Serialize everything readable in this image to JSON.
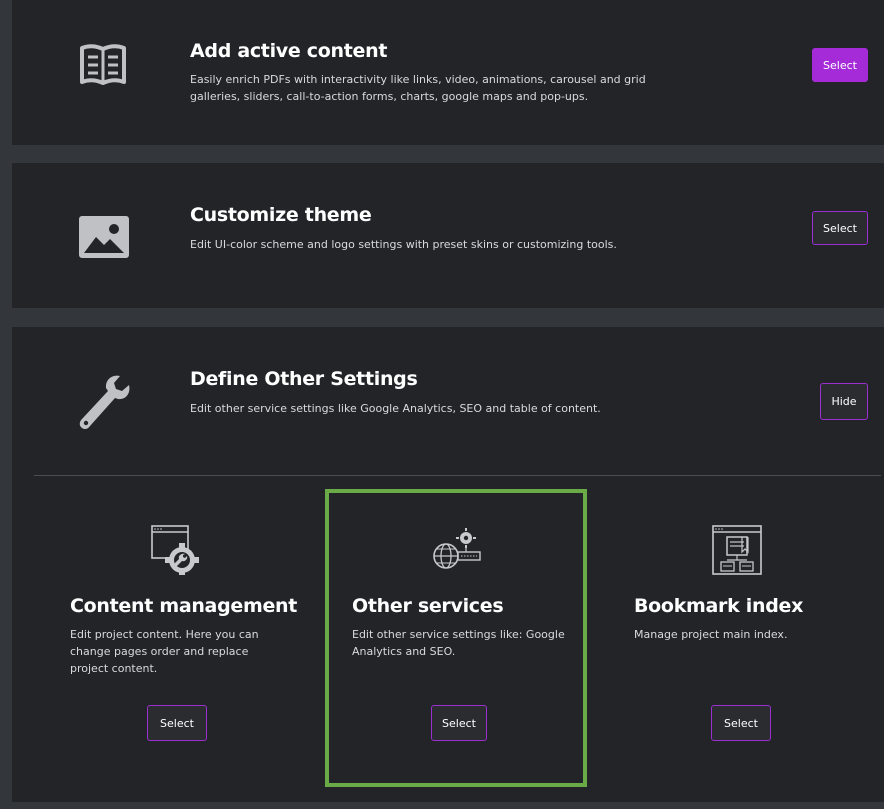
{
  "active_content": {
    "title": "Add active content",
    "description": "Easily enrich PDFs with interactivity like links, video, animations, carousel and grid galleries, sliders, call-to-action forms, charts, google maps and pop-ups.",
    "button_label": "Select",
    "icon": "book-icon"
  },
  "customize_theme": {
    "title": "Customize theme",
    "description": "Edit UI-color scheme and logo settings with preset skins or customizing tools.",
    "button_label": "Select",
    "icon": "image-icon"
  },
  "other_settings": {
    "title": "Define Other Settings",
    "description": "Edit other service settings like Google Analytics, SEO and table of content.",
    "button_label": "Hide",
    "icon": "wrench-icon",
    "cards": [
      {
        "title": "Content management",
        "description": "Edit project content. Here you can change pages order and replace project content.",
        "button_label": "Select",
        "icon": "settings-window-icon"
      },
      {
        "title": "Other services",
        "description": "Edit other service settings like: Google Analytics and SEO.",
        "button_label": "Select",
        "icon": "globe-gear-icon"
      },
      {
        "title": "Bookmark index",
        "description": "Manage project main index.",
        "button_label": "Select",
        "icon": "bookmark-document-icon"
      }
    ]
  },
  "colors": {
    "accent_purple": "#a62bd8",
    "highlight_green": "#6aab47",
    "panel_bg": "#222428",
    "page_bg": "#33373b"
  }
}
